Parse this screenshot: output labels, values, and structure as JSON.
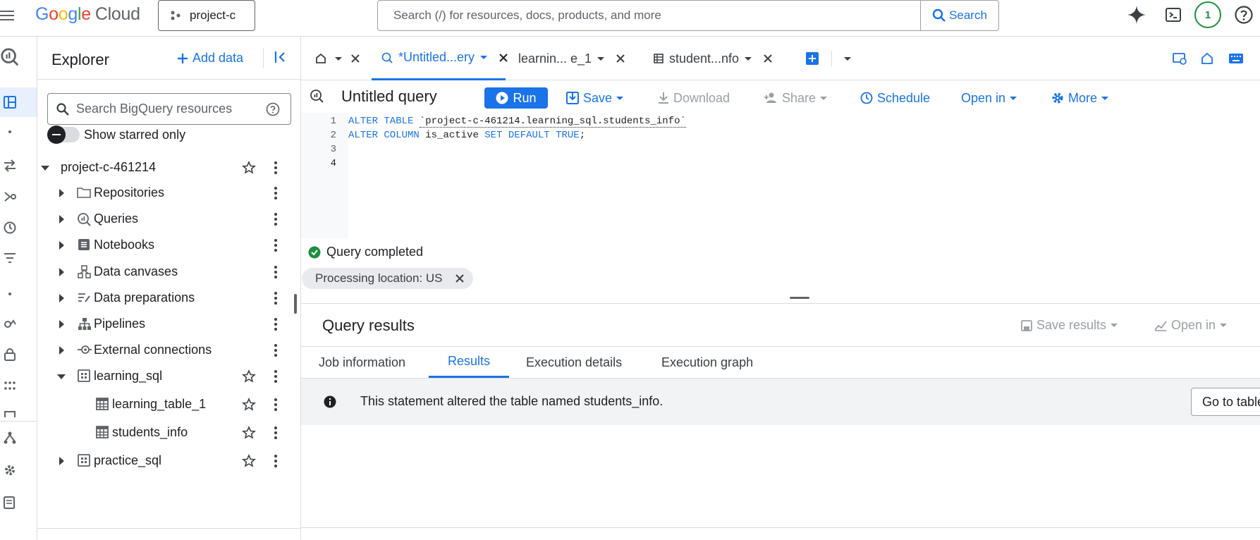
{
  "header": {
    "logo": {
      "g1": "G",
      "g2": "o",
      "g3": "o",
      "g4": "g",
      "g5": "l",
      "g6": "e",
      "cloud": "Cloud"
    },
    "project_label": "project-c",
    "search_placeholder": "Search (/) for resources, docs, products, and more",
    "search_button": "Search",
    "notification_count": "1"
  },
  "explorer": {
    "title": "Explorer",
    "add_data": "Add data",
    "search_placeholder": "Search BigQuery resources",
    "show_starred": "Show starred only",
    "project": "project-c-461214",
    "items": [
      {
        "label": "Repositories"
      },
      {
        "label": "Queries"
      },
      {
        "label": "Notebooks"
      },
      {
        "label": "Data canvases"
      },
      {
        "label": "Data preparations"
      },
      {
        "label": "Pipelines"
      },
      {
        "label": "External connections"
      },
      {
        "label": "learning_sql"
      },
      {
        "label": "learning_table_1"
      },
      {
        "label": "students_info"
      },
      {
        "label": "practice_sql"
      }
    ]
  },
  "tabs": [
    {
      "label": "*Untitled...ery"
    },
    {
      "label": "learnin... e_1"
    },
    {
      "label": "student...nfo"
    }
  ],
  "query": {
    "title": "Untitled query",
    "run": "Run",
    "save": "Save",
    "download": "Download",
    "share": "Share",
    "schedule": "Schedule",
    "open_in": "Open in",
    "more": "More"
  },
  "editor": {
    "line_numbers": [
      "1",
      "2",
      "3",
      "4"
    ],
    "line1": {
      "kw": "ALTER TABLE",
      "str": "`project-c-461214.learning_sql.students_info`"
    },
    "line2": {
      "kw1": "ALTER COLUMN",
      "col": "is_active",
      "kw2": "SET DEFAULT TRUE",
      "end": ";"
    }
  },
  "status": {
    "text": "Query completed",
    "processing_location": "Processing location: US"
  },
  "results": {
    "title": "Query results",
    "save_results": "Save results",
    "open_in": "Open in",
    "tabs": [
      "Job information",
      "Results",
      "Execution details",
      "Execution graph"
    ],
    "active_tab": "Results",
    "message": "This statement altered the table named students_info.",
    "goto_button": "Go to table"
  },
  "colors": {
    "accent": "#1a73e8",
    "success": "#1e8e3e",
    "banner_bg": "#f1f3f4"
  }
}
